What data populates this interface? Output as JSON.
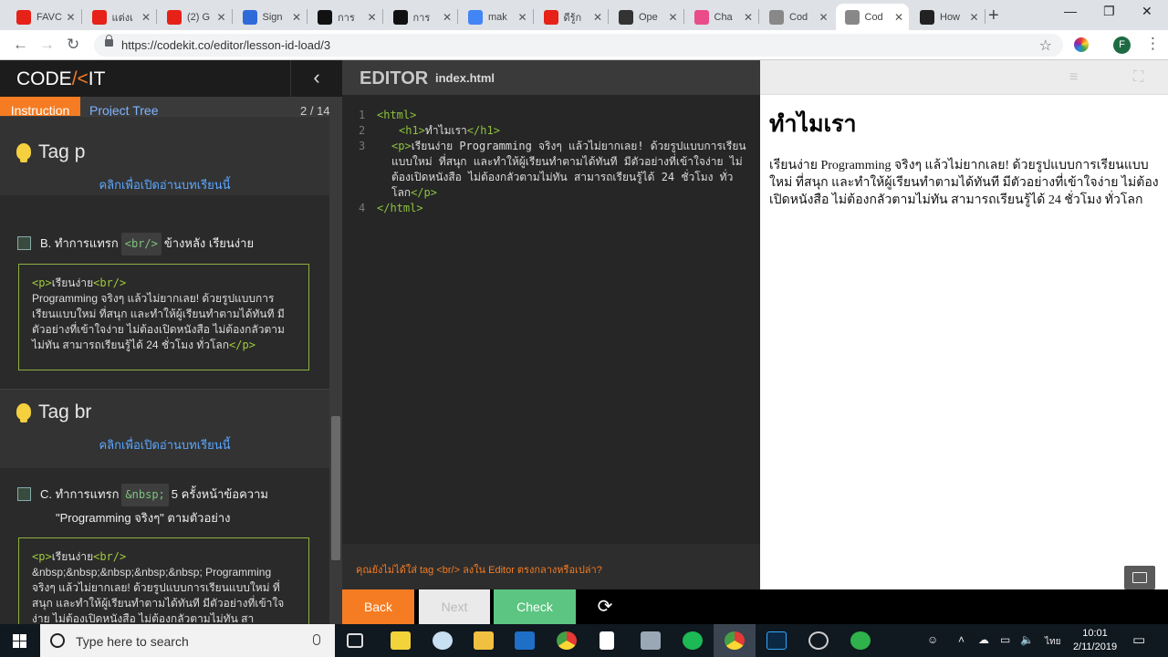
{
  "browser": {
    "tabs": [
      {
        "title": "FAVC",
        "fav": "youtube-icon",
        "color": "#e62117"
      },
      {
        "title": "แต่งเ",
        "fav": "youtube-icon",
        "color": "#e62117"
      },
      {
        "title": "(2) G",
        "fav": "youtube-icon",
        "color": "#e62117"
      },
      {
        "title": "Sign",
        "fav": "hs-icon",
        "color": "#2f6bd8"
      },
      {
        "title": "การ",
        "fav": "medium-icon",
        "color": "#111111"
      },
      {
        "title": "การ",
        "fav": "medium-icon",
        "color": "#111111"
      },
      {
        "title": "mak",
        "fav": "google-icon",
        "color": "#4285f4"
      },
      {
        "title": "ดีรู้ก",
        "fav": "youtube-icon",
        "color": "#e62117"
      },
      {
        "title": "Ope",
        "fav": "openai-icon",
        "color": "#333333"
      },
      {
        "title": "Cha",
        "fav": "dribbble-icon",
        "color": "#ea4c89"
      },
      {
        "title": "Cod",
        "fav": "document-icon",
        "color": "#888888"
      },
      {
        "title": "Cod",
        "fav": "document-icon",
        "color": "#888888",
        "active": true
      },
      {
        "title": "How",
        "fav": "htg-icon",
        "color": "#222222"
      }
    ],
    "url": "https://codekit.co/editor/lesson-id-load/3",
    "profile_initial": "F"
  },
  "sidebar": {
    "logo_left": "CODE",
    "logo_slash": "/<",
    "logo_right": "IT",
    "tabs": {
      "instruction": "Instruction",
      "project_tree": "Project Tree"
    },
    "page": "2 / 14",
    "sections": [
      {
        "title": "Tag p",
        "link": "คลิกเพื่อเปิดอ่านบทเรียนนี้",
        "task_prefix": "B. ทำการแทรก",
        "task_code": "<br/>",
        "task_suffix": "ข้างหลัง เรียนง่าย",
        "task_line2": "",
        "snippet_open": "<p>",
        "snippet_lead": "เรียนง่าย",
        "snippet_br": "<br/>",
        "snippet_body": " Programming จริงๆ แล้วไม่ยากเลย! ด้วยรูปแบบการเรียนแบบใหม่ ที่สนุก และทำให้ผู้เรียนทำตามได้ทันที มีตัวอย่างที่เข้าใจง่าย ไม่ต้องเปิดหนังสือ ไม่ต้องกลัวตามไม่ทัน สามารถเรียนรู้ได้ 24 ชั่วโมง ทั่วโลก",
        "snippet_close": "</p>"
      },
      {
        "title": "Tag br",
        "link": "คลิกเพื่อเปิดอ่านบทเรียนนี้",
        "task_prefix": "C. ทำการแทรก",
        "task_code": "&nbsp;",
        "task_suffix": "5 ครั้งหน้าข้อความ",
        "task_line2": "\"Programming จริงๆ\" ตามตัวอย่าง",
        "snippet_open": "<p>",
        "snippet_lead": "เรียนง่าย",
        "snippet_br": "<br/>",
        "snippet_body": " &nbsp;&nbsp;&nbsp;&nbsp;&nbsp; Programming จริงๆ แล้วไม่ยากเลย! ด้วยรูปแบบการเรียนแบบใหม่ ที่สนุก และทำให้ผู้เรียนทำตามได้ทันที มีตัวอย่างที่เข้าใจง่าย ไม่ต้องเปิดหนังสือ ไม่ต้องกลัวตามไม่ทัน สา",
        "snippet_close": ""
      }
    ]
  },
  "editor": {
    "title": "EDITOR",
    "filename": "index.html",
    "lines": [
      {
        "n": "1",
        "open": "<html>",
        "text": "",
        "close": ""
      },
      {
        "n": "2",
        "open": "<h1>",
        "text": "ทำไมเรา",
        "close": "</h1>"
      },
      {
        "n": "3",
        "open": "<p>",
        "text": "เรียนง่าย Programming จริงๆ แล้วไม่ยากเลย! ด้วยรูปแบบการเรียนแบบใหม่ ที่สนุก และทำให้ผู้เรียนทำตามได้ทันที มีตัวอย่างที่เข้าใจง่าย ไม่ต้องเปิดหนังสือ ไม่ต้องกลัวตามไม่ทัน สามารถเรียนรู้ได้ 24 ชั่วโมง ทั่วโลก",
        "close": "</p>"
      },
      {
        "n": "4",
        "open": "</html>",
        "text": "",
        "close": ""
      }
    ],
    "hint": "คุณยังไม่ได้ใส่ tag <br/> ลงใน Editor ตรงกลางหรือเปล่า?"
  },
  "preview": {
    "heading": "ทำไมเรา",
    "paragraph": "เรียนง่าย Programming จริงๆ แล้วไม่ยากเลย! ด้วยรูปแบบการเรียนแบบใหม่ ที่สนุก และทำให้ผู้เรียนทำตามได้ทันที มีตัวอย่างที่เข้าใจง่าย ไม่ต้องเปิดหนังสือ ไม่ต้องกลัวตามไม่ทัน สามารถเรียนรู้ได้ 24 ชั่วโมง ทั่วโลก"
  },
  "actions": {
    "back": "Back",
    "next": "Next",
    "check": "Check",
    "reload_icon": "reload-icon"
  },
  "taskbar": {
    "search_placeholder": "Type here to search",
    "ime": "ไทย",
    "time": "10:01",
    "date": "2/11/2019"
  },
  "colors": {
    "accent": "#f57c22",
    "check": "#5cc581",
    "code_tag": "#8ec23f",
    "link": "#5aa7ff"
  }
}
